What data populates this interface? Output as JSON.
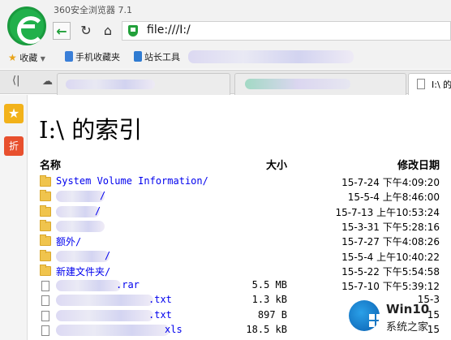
{
  "browser": {
    "app_title": "360安全浏览器 7.1",
    "url": "file:///I:/",
    "favorites": {
      "collect_label": "收藏",
      "mobile_label": "手机收藏夹",
      "webmaster_label": "站长工具"
    },
    "tabs": [
      {
        "label": ""
      },
      {
        "label": ""
      },
      {
        "label": "I:\\ 的"
      }
    ],
    "sidebar": {
      "discount_label": "折"
    }
  },
  "page": {
    "title": "I:\\ 的索引",
    "headers": {
      "name": "名称",
      "size": "大小",
      "modified": "修改日期"
    },
    "rows": [
      {
        "type": "folder",
        "name": "System Volume Information/",
        "size": "",
        "date": "15-7-24 下午4:09:20"
      },
      {
        "type": "folder",
        "name": "/",
        "size": "",
        "date": "15-5-4 上午8:46:00"
      },
      {
        "type": "folder",
        "name": "/",
        "size": "",
        "date": "15-7-13 上午10:53:24"
      },
      {
        "type": "folder",
        "name": "",
        "size": "",
        "date": "15-3-31 下午5:28:16"
      },
      {
        "type": "folder",
        "name": "额外/",
        "size": "",
        "date": "15-7-27 下午4:08:26"
      },
      {
        "type": "folder",
        "name": "/",
        "size": "",
        "date": "15-5-4 上午10:40:22"
      },
      {
        "type": "folder",
        "name": "新建文件夹/",
        "size": "",
        "date": "15-5-22 下午5:54:58"
      },
      {
        "type": "file",
        "name": ".rar",
        "size": "5.5 MB",
        "date": "15-7-10 下午5:39:12"
      },
      {
        "type": "file",
        "name": ".txt",
        "size": "1.3 kB",
        "date": "15-3"
      },
      {
        "type": "file",
        "name": ".txt",
        "size": "897 B",
        "date": "15"
      },
      {
        "type": "file",
        "name": "xls",
        "size": "18.5 kB",
        "date": "15"
      }
    ]
  },
  "watermark": {
    "brand": "Win10",
    "site": "系统之家"
  }
}
